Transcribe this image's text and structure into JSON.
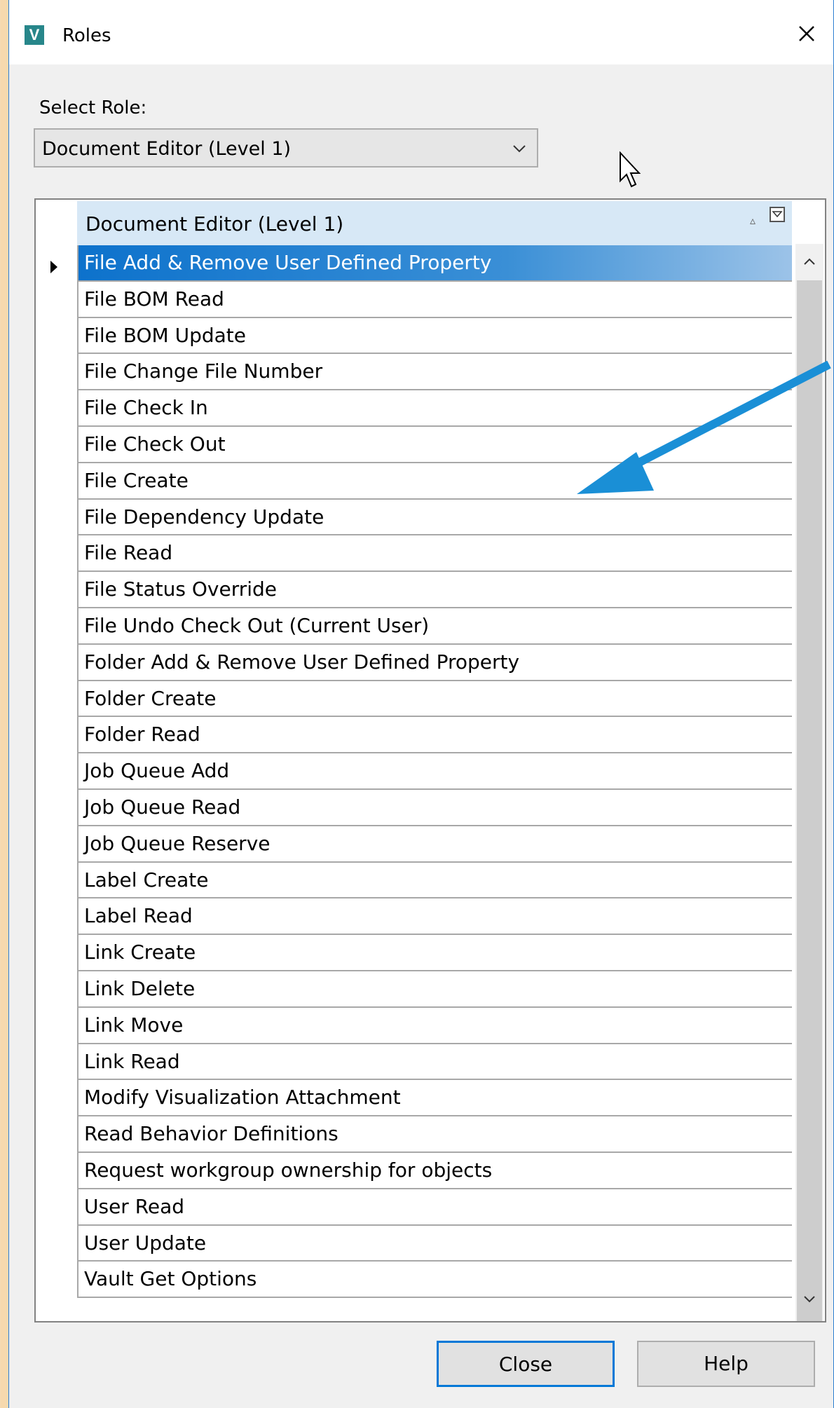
{
  "window": {
    "title": "Roles",
    "app_icon_letter": "V",
    "close_glyph": "×"
  },
  "select_role": {
    "label": "Select Role:",
    "value": "Document Editor (Level 1)"
  },
  "grid": {
    "header": "Document Editor (Level 1)",
    "rows": [
      "File Add & Remove User Defined Property",
      "File BOM Read",
      "File BOM Update",
      "File Change File Number",
      "File Check In",
      "File Check Out",
      "File Create",
      "File Dependency Update",
      "File Read",
      "File Status Override",
      "File Undo Check Out (Current User)",
      "Folder Add & Remove User Defined Property",
      "Folder Create",
      "Folder Read",
      "Job Queue Add",
      "Job Queue Read",
      "Job Queue Reserve",
      "Label Create",
      "Label Read",
      "Link Create",
      "Link Delete",
      "Link Move",
      "Link Read",
      "Modify Visualization Attachment",
      "Read Behavior Definitions",
      "Request workgroup ownership for objects",
      "User Read",
      "User Update",
      "Vault Get Options"
    ],
    "selected_index": 0
  },
  "buttons": {
    "close": "Close",
    "help": "Help"
  },
  "colors": {
    "accent": "#0078d7",
    "annotation_arrow": "#1a8fd6",
    "header_bg": "#d7e8f6"
  }
}
